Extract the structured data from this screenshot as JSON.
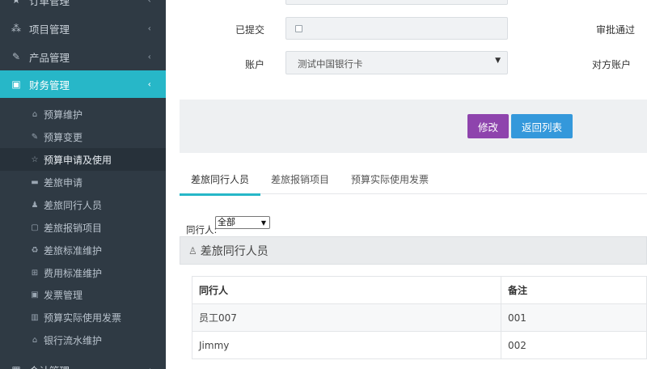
{
  "sidebar": {
    "menus": [
      {
        "label": "订单管理",
        "icon": "star-icon"
      },
      {
        "label": "项目管理",
        "icon": "sitemap-icon"
      },
      {
        "label": "产品管理",
        "icon": "edit-icon"
      },
      {
        "label": "财务管理",
        "icon": "money-icon"
      },
      {
        "label": "会计管理",
        "icon": "calculator-icon"
      }
    ],
    "finance_items": [
      {
        "label": "预算维护",
        "icon": "home-icon"
      },
      {
        "label": "预算变更",
        "icon": "edit-icon"
      },
      {
        "label": "预算申请及使用",
        "icon": "star-half-icon"
      },
      {
        "label": "差旅申请",
        "icon": "car-icon"
      },
      {
        "label": "差旅同行人员",
        "icon": "users-icon"
      },
      {
        "label": "差旅报销项目",
        "icon": "sticky-note-icon"
      },
      {
        "label": "差旅标准维护",
        "icon": "recycle-icon"
      },
      {
        "label": "费用标准维护",
        "icon": "plus-square-icon"
      },
      {
        "label": "发票管理",
        "icon": "money-icon"
      },
      {
        "label": "预算实际使用发票",
        "icon": "map-icon"
      },
      {
        "label": "银行流水维护",
        "icon": "bank-icon"
      }
    ]
  },
  "form": {
    "submitted_label": "已提交",
    "approval_label": "审批通过",
    "account_label": "账户",
    "account_value": "测试中国银行卡",
    "counter_account_label": "对方账户"
  },
  "toolbar": {
    "edit_label": "修改",
    "back_label": "返回列表"
  },
  "tabs": [
    {
      "label": "差旅同行人员"
    },
    {
      "label": "差旅报销项目"
    },
    {
      "label": "预算实际使用发票"
    }
  ],
  "filter": {
    "label": "同行人:",
    "value": "全部"
  },
  "panel": {
    "title": "差旅同行人员"
  },
  "table": {
    "headers": [
      "同行人",
      "备注"
    ],
    "rows": [
      [
        "员工007",
        "001"
      ],
      [
        "Jimmy",
        "002"
      ]
    ]
  },
  "colors": {
    "sidebar_bg": "#2f3a44",
    "active_menu": "#27b7c8",
    "edit_button": "#8e44ad",
    "back_button": "#3498db"
  }
}
